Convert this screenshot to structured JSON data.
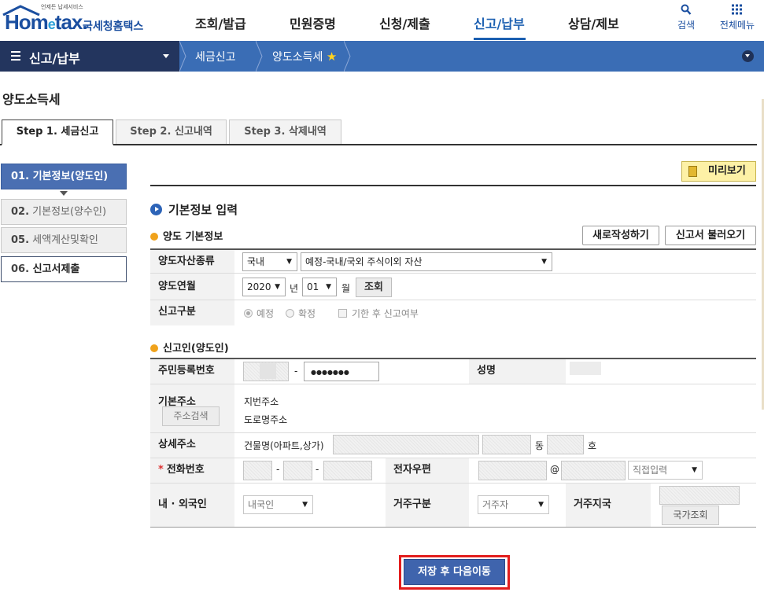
{
  "header": {
    "logo_small": "언제든 납세서비스",
    "logo_brand_a": "Hom",
    "logo_brand_e": "e",
    "logo_brand_b": "tax.",
    "logo_korean": "국세청홈택스",
    "gnb": [
      "조회/발급",
      "민원증명",
      "신청/제출",
      "신고/납부",
      "상담/제보"
    ],
    "search_label": "검색",
    "all_menu_label": "전체메뉴"
  },
  "location": {
    "menu_label": "신고/납부",
    "crumbs": [
      "세금신고",
      "양도소득세"
    ]
  },
  "page": {
    "title": "양도소득세",
    "tabs": [
      "Step 1. 세금신고",
      "Step 2. 신고내역",
      "Step 3. 삭제내역"
    ]
  },
  "steps": [
    {
      "num": "01.",
      "label": "기본정보(양도인)"
    },
    {
      "num": "02.",
      "label": "기본정보(양수인)"
    },
    {
      "num": "05.",
      "label": "세액계산및확인"
    },
    {
      "num": "06.",
      "label": "신고서제출"
    }
  ],
  "main": {
    "preview_label": "미리보기",
    "section_title": "기본정보 입력",
    "transfer_basic": {
      "title": "양도 기본정보",
      "new_btn": "새로작성하기",
      "load_btn": "신고서 불러오기",
      "asset_type_label": "양도자산종류",
      "asset_region": "국내",
      "asset_kind": "예정-국내/국외 주식이외 자산",
      "year_month_label": "양도연월",
      "year": "2020",
      "year_unit": "년",
      "month": "01",
      "month_unit": "월",
      "lookup_btn": "조회",
      "report_type_label": "신고구분",
      "opt_scheduled": "예정",
      "opt_final": "확정",
      "opt_late": "기한 후 신고여부"
    },
    "reporter": {
      "title": "신고인(양도인)",
      "rrn_label": "주민등록번호",
      "rrn_sep": "-",
      "rrn_back": "●●●●●●●",
      "name_label": "성명",
      "address_label": "기본주소",
      "address_search_btn": "주소검색",
      "jibun_label": "지번주소",
      "road_label": "도로명주소",
      "detail_label": "상세주소",
      "building_label": "건물명(아파트,상가)",
      "dong_unit": "동",
      "ho_unit": "호",
      "phone_label": "전화번호",
      "phone_required": "*",
      "phone_sep": "-",
      "email_label": "전자우편",
      "email_at": "@",
      "email_domain_select": "직접입력",
      "nationality_label": "내 · 외국인",
      "nationality_value": "내국인",
      "residence_label": "거주구분",
      "residence_value": "거주자",
      "country_label": "거주지국",
      "country_btn": "국가조회"
    },
    "save_next_btn": "저장 후 다음이동"
  }
}
